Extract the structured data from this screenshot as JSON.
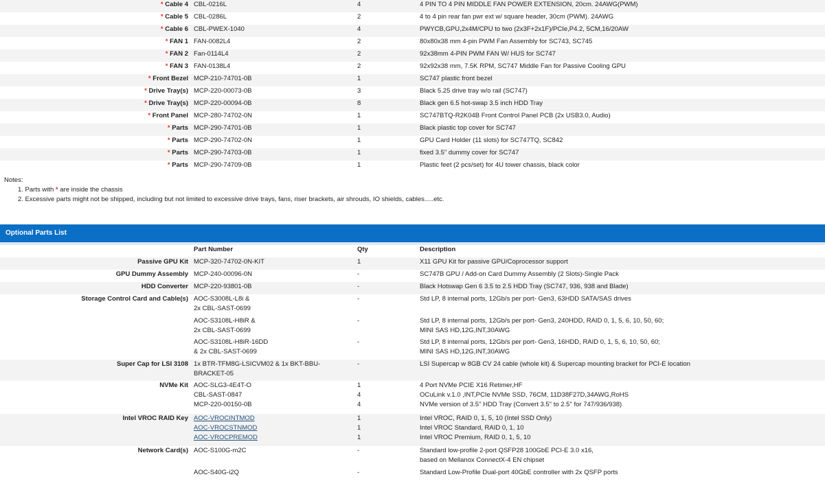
{
  "included": [
    {
      "name": "Cable 4",
      "part": "CBL-0216L",
      "qty": "4",
      "desc": "4 PIN TO 4 PIN MIDDLE FAN POWER EXTENSION, 20cm. 24AWG(PWM)"
    },
    {
      "name": "Cable 5",
      "part": "CBL-0286L",
      "qty": "2",
      "desc": "4 to 4 pin rear fan pwr ext w/ square header, 30cm (PWM). 24AWG"
    },
    {
      "name": "Cable 6",
      "part": "CBL-PWEX-1040",
      "qty": "4",
      "desc": "PWYCB,GPU,2x4M/CPU to two (2x3F+2x1F)/PCIe,P4.2, 5CM,16/20AW"
    },
    {
      "name": "FAN 1",
      "part": "FAN-0082L4",
      "qty": "2",
      "desc": "80x80x38 mm 4-pin PWM Fan Assembly for SC743, SC745"
    },
    {
      "name": "FAN 2",
      "part": "Fan-0114L4",
      "qty": "2",
      "desc": "92x38mm 4-PIN PWM FAN W/ HUS for SC747"
    },
    {
      "name": "FAN 3",
      "part": "FAN-0138L4",
      "qty": "2",
      "desc": "92x92x38 mm, 7.5K RPM, SC747 Middle Fan for Passive Cooling GPU"
    },
    {
      "name": "Front Bezel",
      "part": "MCP-210-74701-0B",
      "qty": "1",
      "desc": "SC747 plastic front bezel"
    },
    {
      "name": "Drive Tray(s)",
      "part": "MCP-220-00073-0B",
      "qty": "3",
      "desc": "Black 5.25 drive tray w/o rail (SC747)"
    },
    {
      "name": "Drive Tray(s)",
      "part": "MCP-220-00094-0B",
      "qty": "8",
      "desc": "Black gen 6.5 hot-swap 3.5 inch HDD Tray"
    },
    {
      "name": "Front Panel",
      "part": "MCP-280-74702-0N",
      "qty": "1",
      "desc": "SC747BTQ-R2K04B Front Control Panel PCB (2x USB3.0, Audio)"
    },
    {
      "name": "Parts",
      "part": "MCP-290-74701-0B",
      "qty": "1",
      "desc": "Black plastic top cover for SC747"
    },
    {
      "name": "Parts",
      "part": "MCP-290-74702-0N",
      "qty": "1",
      "desc": "GPU Card Holder (11 slots) for SC747TQ, SC842"
    },
    {
      "name": "Parts",
      "part": "MCP-290-74703-0B",
      "qty": "1",
      "desc": "fixed 3.5\" dummy cover for SC747"
    },
    {
      "name": "Parts",
      "part": "MCP-290-74709-0B",
      "qty": "1",
      "desc": "Plastic feet (2 pcs/set) for 4U tower chassis, black color"
    }
  ],
  "notes": {
    "title": "Notes:",
    "note1_pre": "1. Parts with ",
    "note1_star": "*",
    "note1_post": " are inside the chassis",
    "note2": "2. Excessive parts might not be shipped, including but not limited to excessive drive trays, fans, riser brackets, air shrouds, IO shields, cables.....etc."
  },
  "star": "*",
  "optional": {
    "title": "Optional Parts List",
    "headers": {
      "part": "Part Number",
      "qty": "Qty",
      "desc": "Description"
    },
    "rows": [
      {
        "name": "Passive GPU Kit",
        "part": "MCP-320-74702-0N-KIT",
        "qty": "1",
        "desc": "X11 GPU Kit for passive GPU/Coprocessor support"
      },
      {
        "name": "GPU Dummy Assembly",
        "part": "MCP-240-00096-0N",
        "qty": "-",
        "desc": "SC747B GPU / Add-on Card Dummy Assembly (2 Slots)-Single Pack"
      },
      {
        "name": "HDD Converter",
        "part": "MCP-220-93801-0B",
        "qty": "-",
        "desc": "Black Hotswap Gen 6 3.5 to 2.5 HDD Tray (SC747, 936, 938 and Blade)"
      },
      {
        "name": "Storage Control Card and Cable(s)",
        "part1": "AOC-S3008L-L8i &",
        "part2": "2x CBL-SAST-0699",
        "qty": "-",
        "desc1": "Std LP, 8 internal ports, 12Gb/s per port- Gen3, 63HDD SATA/SAS drives",
        "desc2": ""
      },
      {
        "name": "",
        "part1": "AOC-S3108L-H8iR &",
        "part2": "2x CBL-SAST-0699",
        "qty": "-",
        "desc1": "Std LP, 8 internal ports, 12Gb/s per port- Gen3, 240HDD, RAID 0, 1, 5, 6, 10, 50, 60;",
        "desc2": "MINI SAS HD,12G,INT,30AWG"
      },
      {
        "name": "",
        "part1": "AOC-S3108L-H8iR-16DD",
        "part2": "& 2x CBL-SAST-0699",
        "qty": "-",
        "desc1": "Std LP, 8 internal ports, 12Gb/s per port- Gen3, 16HDD, RAID 0, 1, 5, 6, 10, 50, 60;",
        "desc2": "MINI SAS HD,12G,INT,30AWG"
      },
      {
        "name": "Super Cap for LSI 3108",
        "part1": "1x BTR-TFM8G-LSICVM02 & 1x BKT-BBU-",
        "part2": "BRACKET-05",
        "qty": "-",
        "desc1": "LSI Supercap w 8GB CV 24 cable (whole kit) & Supercap mounting bracket for PCI-E location",
        "desc2": ""
      },
      {
        "name": "NVMe Kit",
        "parts": [
          "AOC-SLG3-4E4T-O",
          "CBL-SAST-0847",
          "MCP-220-00150-0B"
        ],
        "qtys": [
          "1",
          "4",
          "4"
        ],
        "descs": [
          "4 Port NVMe PCIE X16 Retimer,HF",
          "OCuLink v.1.0 ,INT,PCIe NVMe SSD, 76CM, 11D38F27D,34AWG,RoHS",
          "NVMe version of 3.5\" HDD Tray (Convert 3.5\" to 2.5\" for 747/936/938)"
        ]
      },
      {
        "name": "Intel VROC RAID Key",
        "parts": [
          "AOC-VROCINTMOD",
          "AOC-VROCSTNMOD",
          "AOC-VROCPREMOD"
        ],
        "qtys": [
          "1",
          "1",
          "1"
        ],
        "descs": [
          "Intel VROC, RAID 0, 1, 5, 10 (Intel SSD Only)",
          "Intel VROC Standard, RAID 0, 1, 10",
          "Intel VROC Premium, RAID 0, 1, 5, 10"
        ]
      },
      {
        "name": "Network Card(s)",
        "part1": "AOC-S100G-m2C",
        "part2": "",
        "qty": "-",
        "desc1": "Standard low-profile 2-port QSFP28 100GbE PCI-E 3.0 x16,",
        "desc2": "based on Mellanox ConnectX-4 EN chipset"
      },
      {
        "name": "",
        "part1": "AOC-S40G-i2Q",
        "part2": "",
        "qty": "-",
        "desc1": "Standard Low-Profile Dual-port 40GbE controller with 2x QSFP ports",
        "desc2": ""
      }
    ]
  }
}
